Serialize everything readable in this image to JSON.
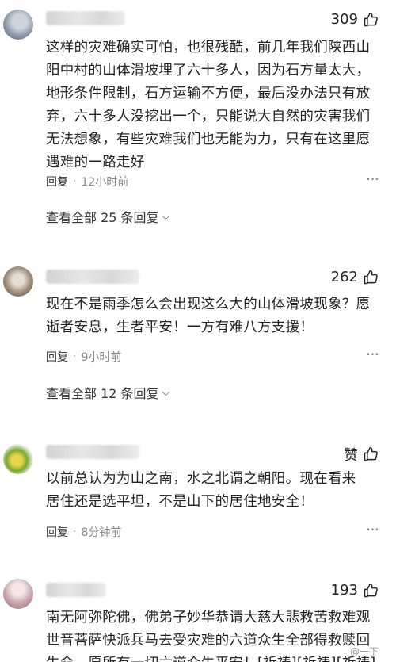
{
  "comments": [
    {
      "likes": "309",
      "text": "这样的灾难确实可怕，也很残酷，前几年我们陕西山阳中村的山体滑坡埋了六十多人，因为石方量太大，地形条件限制，石方运输不方便，最后没办法只有放弃，六十多人没挖出一个，只能说大自然的灾害我们无法想象，有些灾难我们也无能为力，只有在这里愿遇难的一路走好",
      "reply_label": "回复",
      "time": "12小时前",
      "more": "···",
      "view_replies": "查看全部 25 条回复"
    },
    {
      "likes": "262",
      "text": "现在不是雨季怎么会出现这么大的山体滑坡现象？愿逝者安息，生者平安！一方有难八方支援！",
      "reply_label": "回复",
      "time": "9小时前",
      "more": "···",
      "view_replies": "查看全部 12 条回复"
    },
    {
      "likes": "赞",
      "text": "以前总认为为山之南，水之北谓之朝阳。现在看来居住还是选平坦，不是山下的居住地安全！",
      "reply_label": "回复",
      "time": "8分钟前",
      "more": "···"
    },
    {
      "likes": "193",
      "text": "南无阿弥陀佛，佛弟子妙华恭请大慈大悲救苦救难观世音菩萨快派兵马去受灾难的六道众生全部得救赎回生命，愿所有一切六道众生平安！[祈祷][祈祷][祈祷]"
    }
  ],
  "separator": "·",
  "chevron": "⌵",
  "watermark": "@一下"
}
